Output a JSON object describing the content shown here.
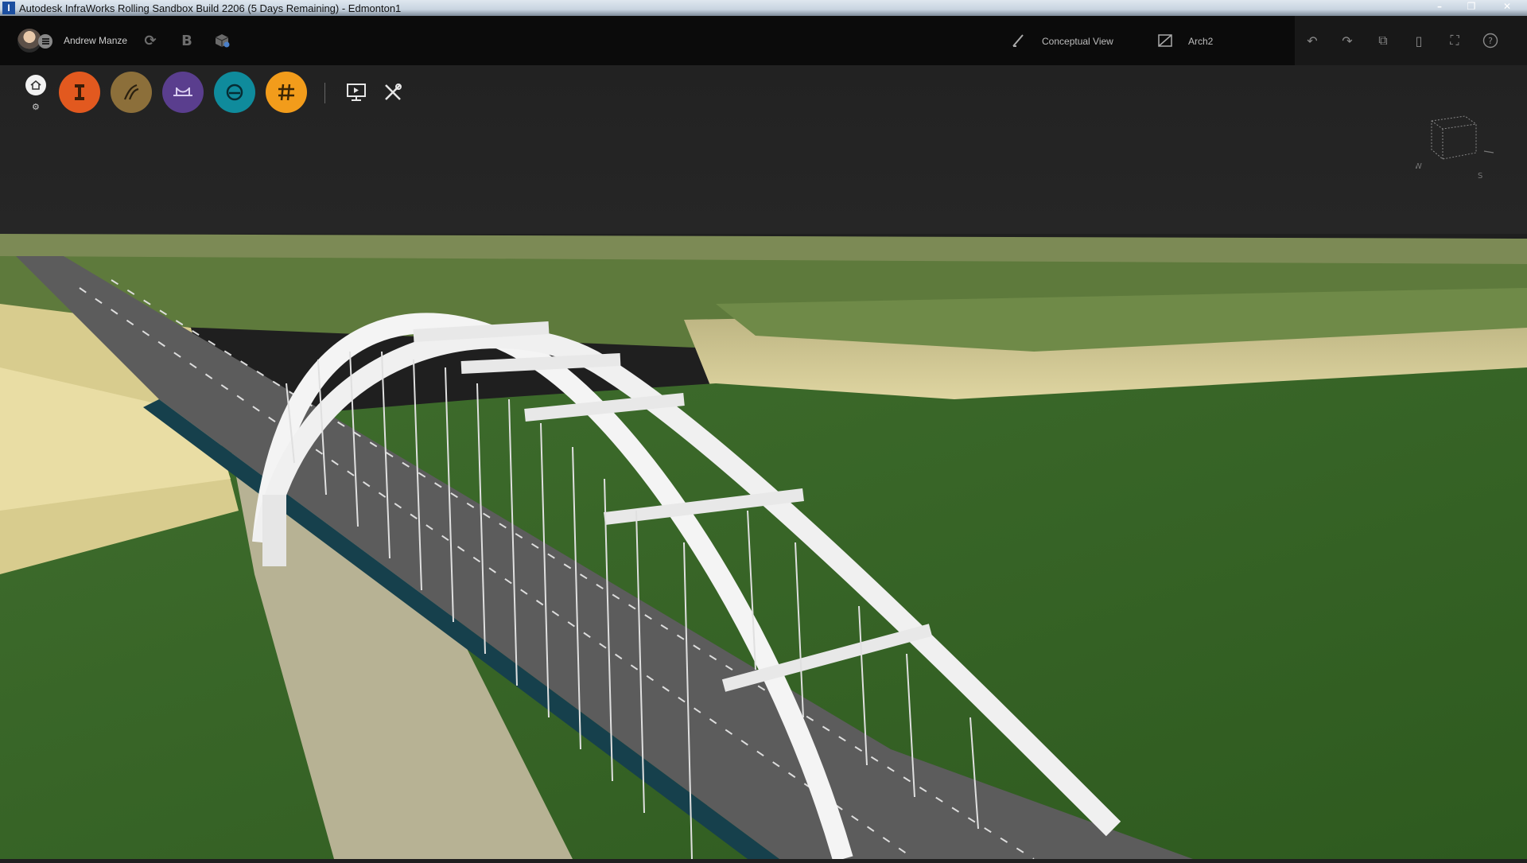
{
  "window": {
    "title": "Autodesk InfraWorks Rolling Sandbox Build 2206 (5 Days Remaining) - Edmonton1",
    "app_icon": "I",
    "controls": [
      "minimize-icon",
      "restore-icon",
      "close-icon"
    ]
  },
  "appbar": {
    "user_name": "Andrew Manze",
    "icons": [
      "sync-icon",
      "bim360-icon",
      "model-cube-icon"
    ],
    "bim_label": "B",
    "view_style": "Conceptual View",
    "proposal": "Arch2",
    "right_icons": [
      "undo-icon",
      "redo-icon",
      "window-icon",
      "panel-icon",
      "fullscreen-icon",
      "help-icon"
    ]
  },
  "ribbon": {
    "home": "home-icon",
    "settings": "gear-icon",
    "tools": [
      {
        "name": "structure-tool",
        "color": "#e2591f",
        "icon": "beam-icon"
      },
      {
        "name": "roads-tool",
        "color": "#8c6f3a",
        "icon": "road-icon"
      },
      {
        "name": "bridges-tool",
        "color": "#5a3e8e",
        "icon": "bridge-icon"
      },
      {
        "name": "drainage-tool",
        "color": "#0f8b9c",
        "icon": "pipe-icon"
      },
      {
        "name": "grid-tool",
        "color": "#f29c1b",
        "icon": "grid-icon"
      }
    ],
    "present_icon": "presentation-icon",
    "settings_tools_icon": "tools-icon"
  },
  "viewcube": {
    "compass": [
      "W",
      "S"
    ]
  }
}
